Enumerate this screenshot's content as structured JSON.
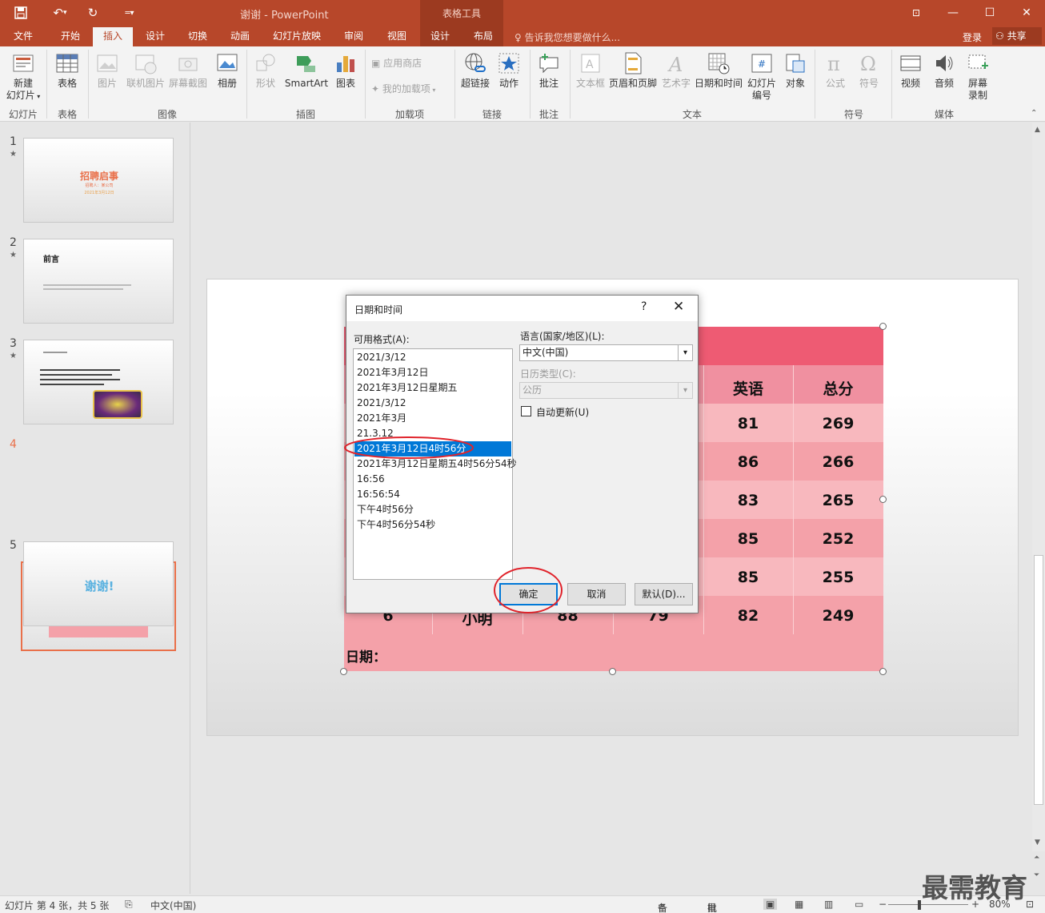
{
  "app": {
    "doc_title": "谢谢 - PowerPoint",
    "tool_tabs_header": "表格工具"
  },
  "qat": {
    "save_icon": "save-icon",
    "undo_icon": "undo-icon",
    "redo_icon": "redo-icon",
    "customize_icon": "customize-icon"
  },
  "tabs": [
    "文件",
    "开始",
    "插入",
    "设计",
    "切换",
    "动画",
    "幻灯片放映",
    "审阅",
    "视图",
    "设计",
    "布局"
  ],
  "tellme": "告诉我您想要做什么...",
  "account": {
    "login": "登录",
    "share": "共享"
  },
  "ribbon": {
    "buttons": [
      "新建\n幻灯片",
      "表格",
      "图片",
      "联机图片",
      "屏幕截图",
      "相册",
      "形状",
      "SmartArt",
      "图表",
      "应用商店",
      "我的加载项",
      "超链接",
      "动作",
      "批注",
      "文本框",
      "页眉和页脚",
      "艺术字",
      "日期和时间",
      "幻灯片\n编号",
      "对象",
      "公式",
      "符号",
      "视频",
      "音频",
      "屏幕\n录制"
    ],
    "groups": [
      "幻灯片",
      "表格",
      "图像",
      "插图",
      "加载项",
      "链接",
      "批注",
      "文本",
      "符号",
      "媒体"
    ]
  },
  "slides": {
    "numbers": [
      "1",
      "2",
      "3",
      "4",
      "5"
    ],
    "star": "★",
    "s1_title": "招聘启事",
    "s1_sub": "招聘人：某公司",
    "s1_date": "2021年3月12日",
    "s2_title": "前言",
    "s5_title": "谢谢!"
  },
  "table": {
    "headers": [
      "英语",
      "总分"
    ],
    "rows": [
      [
        "81",
        "269"
      ],
      [
        "86",
        "266"
      ],
      [
        "83",
        "265"
      ],
      [
        "85",
        "252"
      ],
      [
        "85",
        "255"
      ],
      [
        "6",
        "小明",
        "88",
        "79",
        "82",
        "249"
      ]
    ],
    "footer": "日期："
  },
  "dialog": {
    "title": "日期和时间",
    "help": "?",
    "close": "✕",
    "formats_label": "可用格式(A):",
    "formats": [
      "2021/3/12",
      "2021年3月12日",
      "2021年3月12日星期五",
      "2021/3/12",
      "2021年3月",
      "21.3.12",
      "2021年3月12日4时56分",
      "2021年3月12日星期五4时56分54秒",
      "16:56",
      "16:56:54",
      "下午4时56分",
      "下午4时56分54秒"
    ],
    "selected_index": 6,
    "language_label": "语言(国家/地区)(L):",
    "language_value": "中文(中国)",
    "calendar_label": "日历类型(C):",
    "calendar_value": "公历",
    "auto_update": "自动更新(U)",
    "ok": "确定",
    "cancel": "取消",
    "default": "默认(D)..."
  },
  "status": {
    "slide_info": "幻灯片 第 4 张，共 5 张",
    "language": "中文(中国)",
    "notes": "备注",
    "comments": "批注",
    "zoom": "80%"
  },
  "watermark": "最需教育",
  "colors": {
    "accent": "#b7472a",
    "table_header": "#ee5b73",
    "table_body": "#f4a1a9",
    "selection": "#0078d7",
    "annotation": "#e0232b"
  }
}
